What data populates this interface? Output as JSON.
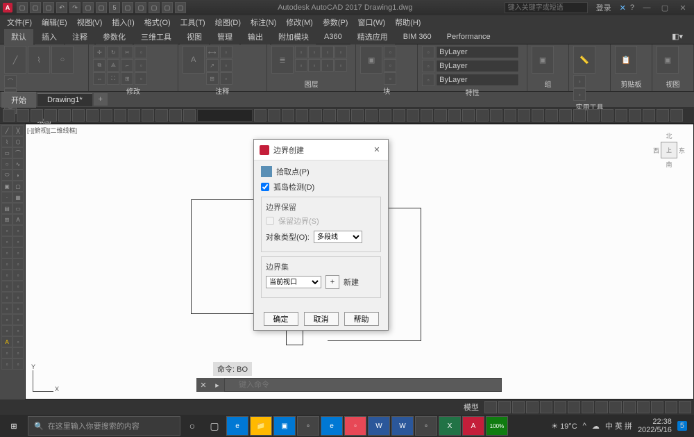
{
  "app": {
    "title": "Autodesk AutoCAD 2017   Drawing1.dwg",
    "search_placeholder": "键入关键字或短语",
    "login": "登录"
  },
  "menu": [
    "文件(F)",
    "编辑(E)",
    "视图(V)",
    "插入(I)",
    "格式(O)",
    "工具(T)",
    "绘图(D)",
    "标注(N)",
    "修改(M)",
    "参数(P)",
    "窗口(W)",
    "帮助(H)"
  ],
  "ribbon_tabs": [
    "默认",
    "插入",
    "注释",
    "参数化",
    "三维工具",
    "视图",
    "管理",
    "输出",
    "附加模块",
    "A360",
    "精选应用",
    "BIM 360",
    "Performance"
  ],
  "ribbon_panels": [
    "绘图",
    "修改",
    "注释",
    "图层",
    "块",
    "特性",
    "组",
    "实用工具",
    "剪贴板",
    "视图"
  ],
  "layer_text": "ByLayer",
  "file_tabs": {
    "start": "开始",
    "drawing": "Drawing1*"
  },
  "canvas_label": "[-][俯视][二维线框]",
  "viewcube": {
    "n": "北",
    "w": "西",
    "e": "东",
    "s": "南"
  },
  "ucs": {
    "x": "X",
    "y": "Y"
  },
  "dialog": {
    "title": "边界创建",
    "pick_points": "拾取点(P)",
    "island_detect": "孤岛检测(D)",
    "boundary_retain_group": "边界保留",
    "retain_boundary": "保留边界(S)",
    "object_type_label": "对象类型(O):",
    "object_type_value": "多段线",
    "boundary_set_group": "边界集",
    "boundary_set_value": "当前视口",
    "new_btn": "新建",
    "ok": "确定",
    "cancel": "取消",
    "help": "帮助"
  },
  "cmd": {
    "label": "命令: BO",
    "placeholder": "键入命令"
  },
  "status_model": "模型",
  "taskbar": {
    "search_placeholder": "在这里输入你要搜索的内容",
    "weather": "19°C",
    "ime": "中 英  拼",
    "time": "22:38",
    "date": "2022/5/16",
    "notif": "5"
  }
}
